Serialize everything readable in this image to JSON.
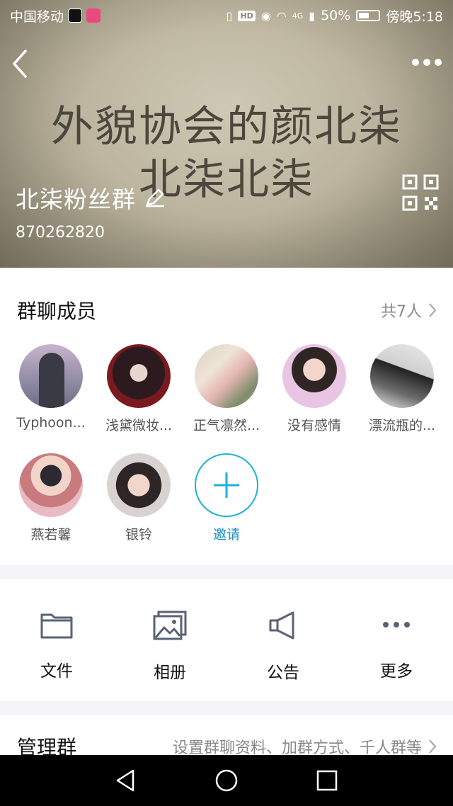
{
  "status_bar": {
    "carrier": "中国移动",
    "hd": "HD",
    "network": "4G",
    "battery": "50%",
    "time": "傍晚5:18"
  },
  "cover": {
    "line1": "外貌协会的颜北柒",
    "line2": "北柒北柒"
  },
  "group": {
    "name": "北柒粉丝群",
    "id": "870262820"
  },
  "members_section": {
    "title": "群聊成员",
    "count": "共7人",
    "members": [
      {
        "name": "Typhoon..."
      },
      {
        "name": "浅黛微妆..."
      },
      {
        "name": "正气凛然..."
      },
      {
        "name": "没有感情"
      },
      {
        "name": "漂流瓶的..."
      },
      {
        "name": "燕若馨"
      },
      {
        "name": "银铃"
      }
    ],
    "invite_label": "邀请"
  },
  "tools": [
    {
      "label": "文件",
      "icon": "folder-icon"
    },
    {
      "label": "相册",
      "icon": "album-icon"
    },
    {
      "label": "公告",
      "icon": "megaphone-icon"
    },
    {
      "label": "更多",
      "icon": "more-icon"
    }
  ],
  "manage": {
    "title": "管理群",
    "desc": "设置群聊资料、加群方式、千人群等"
  },
  "colors": {
    "accent": "#1fb1d6",
    "banner": "#b9b19b"
  }
}
